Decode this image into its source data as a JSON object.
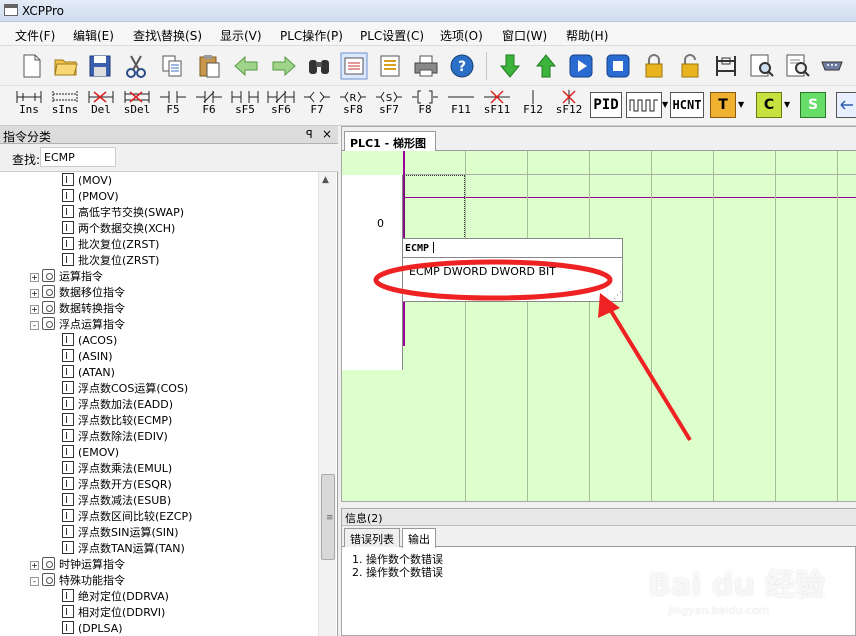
{
  "window": {
    "title": "XCPPro"
  },
  "menu": [
    "文件(F)",
    "编辑(E)",
    "查找\\替换(S)",
    "显示(V)",
    "PLC操作(P)",
    "PLC设置(C)",
    "选项(O)",
    "窗口(W)",
    "帮助(H)"
  ],
  "ladder_toolbar": [
    {
      "label": "Ins"
    },
    {
      "label": "sIns"
    },
    {
      "label": "Del"
    },
    {
      "label": "sDel"
    },
    {
      "label": "F5"
    },
    {
      "label": "F6"
    },
    {
      "label": "sF5"
    },
    {
      "label": "sF6"
    },
    {
      "label": "F7"
    },
    {
      "label": "sF8"
    },
    {
      "label": "sF7"
    },
    {
      "label": "F8"
    },
    {
      "label": "F11"
    },
    {
      "label": "sF11"
    },
    {
      "label": "F12"
    },
    {
      "label": "sF12"
    }
  ],
  "big_buttons": {
    "pid": "PID",
    "hcnt": "HCNT",
    "t": "T",
    "c": "C",
    "s": "S"
  },
  "left_panel": {
    "title": "指令分类",
    "pin": "ꟼ",
    "close": "×",
    "search_label": "查找:",
    "search_value": "ECMP",
    "tree": [
      {
        "text": "(MOV)",
        "kind": "leaf",
        "level": 2
      },
      {
        "text": "(PMOV)",
        "kind": "leaf",
        "level": 2
      },
      {
        "text": "高低字节交换(SWAP)",
        "kind": "leaf",
        "level": 2
      },
      {
        "text": "两个数据交换(XCH)",
        "kind": "leaf",
        "level": 2
      },
      {
        "text": "批次复位(ZRST)",
        "kind": "leaf",
        "level": 2
      },
      {
        "text": "批次复位(ZRST)",
        "kind": "leaf",
        "level": 2
      },
      {
        "text": "运算指令",
        "kind": "folder",
        "level": 1,
        "exp": "+"
      },
      {
        "text": "数据移位指令",
        "kind": "folder",
        "level": 1,
        "exp": "+"
      },
      {
        "text": "数据转换指令",
        "kind": "folder",
        "level": 1,
        "exp": "+"
      },
      {
        "text": "浮点运算指令",
        "kind": "folder",
        "level": 1,
        "exp": "-"
      },
      {
        "text": "(ACOS)",
        "kind": "leaf",
        "level": 2
      },
      {
        "text": "(ASIN)",
        "kind": "leaf",
        "level": 2
      },
      {
        "text": "(ATAN)",
        "kind": "leaf",
        "level": 2
      },
      {
        "text": "浮点数COS运算(COS)",
        "kind": "leaf",
        "level": 2
      },
      {
        "text": "浮点数加法(EADD)",
        "kind": "leaf",
        "level": 2
      },
      {
        "text": "浮点数比较(ECMP)",
        "kind": "leaf",
        "level": 2
      },
      {
        "text": "浮点数除法(EDIV)",
        "kind": "leaf",
        "level": 2
      },
      {
        "text": "(EMOV)",
        "kind": "leaf",
        "level": 2
      },
      {
        "text": "浮点数乘法(EMUL)",
        "kind": "leaf",
        "level": 2
      },
      {
        "text": "浮点数开方(ESQR)",
        "kind": "leaf",
        "level": 2
      },
      {
        "text": "浮点数减法(ESUB)",
        "kind": "leaf",
        "level": 2
      },
      {
        "text": "浮点数区间比较(EZCP)",
        "kind": "leaf",
        "level": 2
      },
      {
        "text": "浮点数SIN运算(SIN)",
        "kind": "leaf",
        "level": 2
      },
      {
        "text": "浮点数TAN运算(TAN)",
        "kind": "leaf",
        "level": 2
      },
      {
        "text": "时钟运算指令",
        "kind": "folder",
        "level": 1,
        "exp": "+"
      },
      {
        "text": "特殊功能指令",
        "kind": "folder",
        "level": 1,
        "exp": "-"
      },
      {
        "text": "绝对定位(DDRVA)",
        "kind": "leaf",
        "level": 2
      },
      {
        "text": "相对定位(DDRVI)",
        "kind": "leaf",
        "level": 2
      },
      {
        "text": "(DPLSA)",
        "kind": "leaf",
        "level": 2
      }
    ]
  },
  "editor": {
    "tab": "PLC1 - 梯形图",
    "rung_number": "0",
    "input_text": "ECMP",
    "hint": "ECMP DWORD DWORD BIT"
  },
  "info_panel": {
    "title": "信息(2)",
    "tabs": [
      "错误列表",
      "输出"
    ],
    "messages": [
      "1. 操作数个数错误",
      "2. 操作数个数错误"
    ]
  },
  "watermark": {
    "brand": "Bai du 经验",
    "url": "jingyan.baidu.com"
  },
  "colors": {
    "ladder_bg": "#ddffcc",
    "rail": "#990099",
    "annotation": "#ee2222"
  }
}
